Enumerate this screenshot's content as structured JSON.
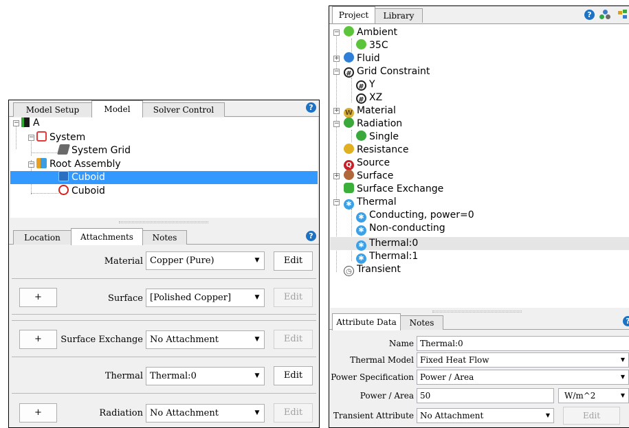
{
  "left_panel": {
    "tabs": [
      "Model Setup",
      "Model",
      "Solver Control"
    ],
    "tree": [
      {
        "label": "A",
        "icon": "model-icon"
      },
      {
        "label": "System",
        "icon": "system-icon"
      },
      {
        "label": "System Grid",
        "icon": "system-grid-icon"
      },
      {
        "label": "Root Assembly",
        "icon": "assembly-icon"
      },
      {
        "label": "Cuboid",
        "icon": "cuboid-icon",
        "selected": true
      },
      {
        "label": "Cuboid",
        "icon": "cuboid-target-icon"
      }
    ],
    "attr_tabs": [
      "Location",
      "Attachments",
      "Notes"
    ],
    "rows": [
      {
        "label": "Material",
        "value": "Copper (Pure)",
        "edit": "Edit",
        "edit_enabled": true,
        "plus": ""
      },
      {
        "label": "Surface",
        "value": "[Polished Copper]",
        "edit": "Edit",
        "edit_enabled": false,
        "plus": "+"
      },
      {
        "label": "Surface Exchange",
        "value": "No Attachment",
        "edit": "Edit",
        "edit_enabled": false,
        "plus": "+"
      },
      {
        "label": "Thermal",
        "value": "Thermal:0",
        "edit": "Edit",
        "edit_enabled": true,
        "plus": ""
      },
      {
        "label": "Radiation",
        "value": "No Attachment",
        "edit": "Edit",
        "edit_enabled": false,
        "plus": "+"
      }
    ]
  },
  "right_panel": {
    "tabs": [
      "Project",
      "Library"
    ],
    "tree": [
      {
        "label": "Ambient",
        "icon": "ambient-icon",
        "color": "#5cc43a"
      },
      {
        "label": "35C",
        "icon": "ambient-icon",
        "color": "#5cc43a"
      },
      {
        "label": "Fluid",
        "icon": "fluid-icon",
        "color": "#2f7fd6"
      },
      {
        "label": "Grid Constraint",
        "icon": "grid-constraint-icon",
        "color": "#202020"
      },
      {
        "label": "Y",
        "icon": "grid-constraint-icon",
        "color": "#202020"
      },
      {
        "label": "XZ",
        "icon": "grid-constraint-icon",
        "color": "#202020"
      },
      {
        "label": "Material",
        "icon": "material-icon",
        "color": "#d8b33a"
      },
      {
        "label": "Radiation",
        "icon": "radiation-icon",
        "color": "#3aa83a"
      },
      {
        "label": "Single",
        "icon": "radiation-icon",
        "color": "#3aa83a"
      },
      {
        "label": "Resistance",
        "icon": "resistance-icon",
        "color": "#e0b020"
      },
      {
        "label": "Source",
        "icon": "source-icon",
        "color": "#c8202a"
      },
      {
        "label": "Surface",
        "icon": "surface-icon",
        "color": "#b0683a"
      },
      {
        "label": "Surface Exchange",
        "icon": "surface-exchange-icon",
        "color": "#3ab03a"
      },
      {
        "label": "Thermal",
        "icon": "thermal-icon",
        "color": "#3aa0e8"
      },
      {
        "label": "Conducting, power=0",
        "icon": "thermal-icon",
        "color": "#3aa0e8"
      },
      {
        "label": "Non-conducting",
        "icon": "thermal-icon",
        "color": "#3aa0e8"
      },
      {
        "label": "Thermal:0",
        "icon": "thermal-icon",
        "color": "#3aa0e8"
      },
      {
        "label": "Thermal:1",
        "icon": "thermal-icon",
        "color": "#3aa0e8"
      },
      {
        "label": "Transient",
        "icon": "transient-icon",
        "color": "#ffffff"
      }
    ],
    "attr_tabs": [
      "Attribute Data",
      "Notes"
    ],
    "fields": {
      "name_label": "Name",
      "name_value": "Thermal:0",
      "thermal_model_label": "Thermal Model",
      "thermal_model_value": "Fixed Heat Flow",
      "power_spec_label": "Power Specification",
      "power_spec_value": "Power / Area",
      "power_area_label": "Power / Area",
      "power_area_value": "50",
      "power_area_unit": "W/m^2",
      "transient_label": "Transient Attribute",
      "transient_value": "No Attachment",
      "edit_label": "Edit"
    }
  },
  "help_glyph": "?",
  "colors": {
    "selection": "#3399ff",
    "help": "#1d72c4"
  }
}
